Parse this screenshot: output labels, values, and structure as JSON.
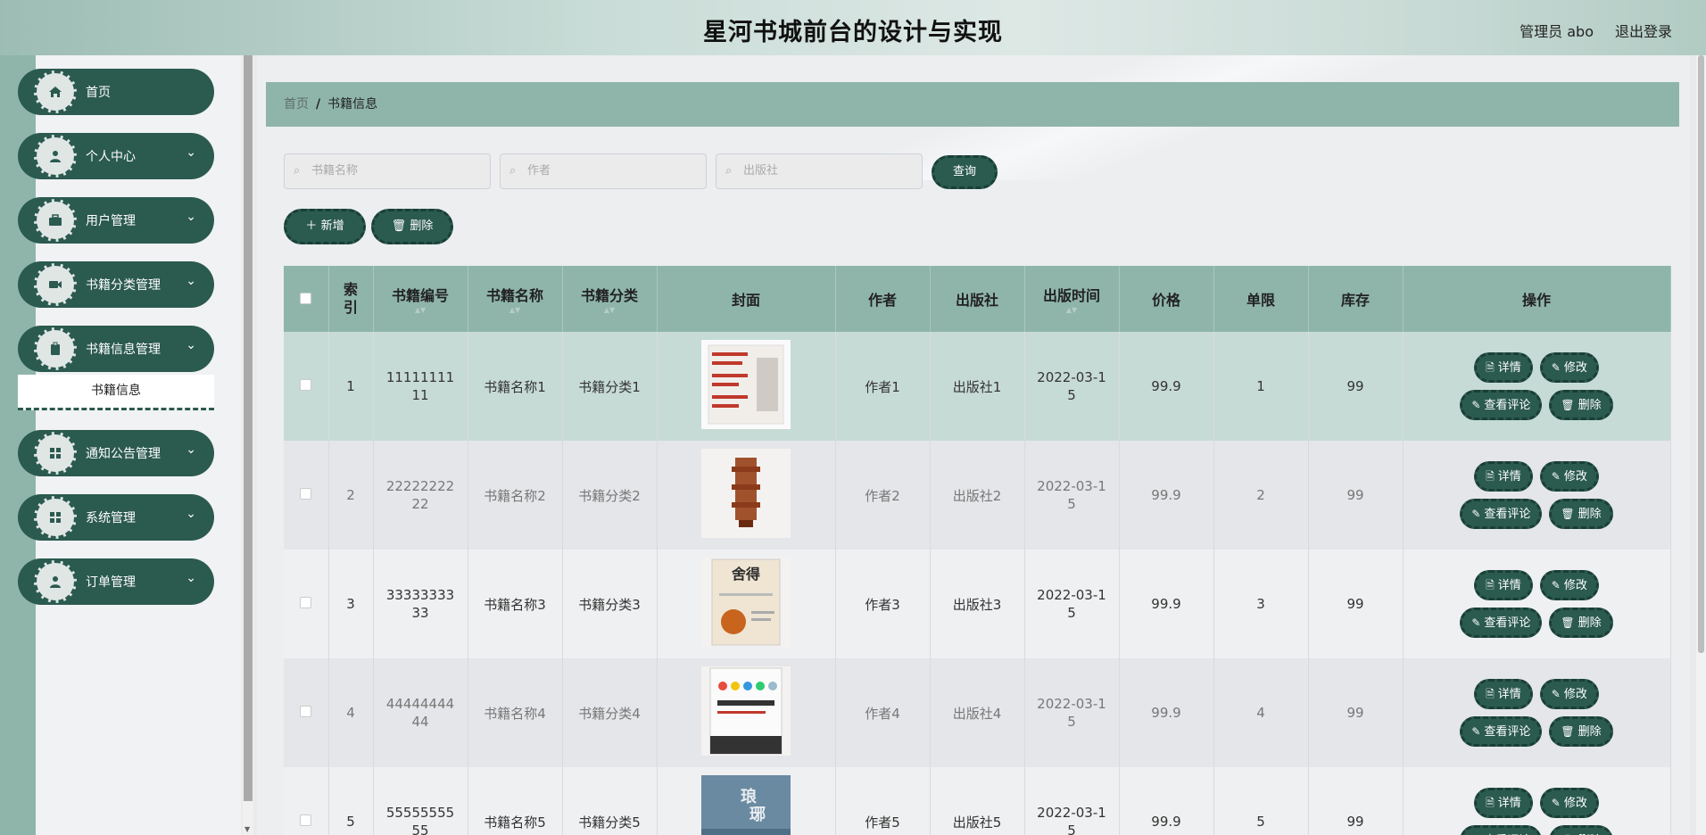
{
  "header": {
    "title": "星河书城前台的设计与实现",
    "user": "管理员 abo",
    "logout": "退出登录"
  },
  "sidebar": {
    "items": [
      {
        "label": "首页",
        "icon": "home-icon",
        "expandable": false
      },
      {
        "label": "个人中心",
        "icon": "user-icon",
        "expandable": true
      },
      {
        "label": "用户管理",
        "icon": "briefcase-icon",
        "expandable": true
      },
      {
        "label": "书籍分类管理",
        "icon": "video-icon",
        "expandable": true
      },
      {
        "label": "书籍信息管理",
        "icon": "clipboard-icon",
        "expandable": true
      },
      {
        "label": "通知公告管理",
        "icon": "grid-icon",
        "expandable": true
      },
      {
        "label": "系统管理",
        "icon": "grid-icon",
        "expandable": true
      },
      {
        "label": "订单管理",
        "icon": "user-icon",
        "expandable": true
      }
    ],
    "submenu_label": "书籍信息"
  },
  "breadcrumb": {
    "home": "首页",
    "separator": "/",
    "current": "书籍信息"
  },
  "search": {
    "name_placeholder": "书籍名称",
    "author_placeholder": "作者",
    "publisher_placeholder": "出版社",
    "query_label": "查询"
  },
  "toolbar": {
    "add_label": "新增",
    "delete_label": "删除"
  },
  "table": {
    "headers": {
      "index": "索引",
      "code": "书籍编号",
      "name": "书籍名称",
      "category": "书籍分类",
      "cover": "封面",
      "author": "作者",
      "publisher": "出版社",
      "date": "出版时间",
      "price": "价格",
      "limit": "单限",
      "stock": "库存",
      "actions": "操作"
    },
    "action_labels": {
      "detail": "详情",
      "edit": "修改",
      "comments": "查看评论",
      "delete": "删除"
    },
    "rows": [
      {
        "index": "1",
        "code": "1111111111",
        "name": "书籍名称1",
        "category": "书籍分类1",
        "author": "作者1",
        "publisher": "出版社1",
        "date": "2022-03-15",
        "price": "99.9",
        "limit": "1",
        "stock": "99"
      },
      {
        "index": "2",
        "code": "2222222222",
        "name": "书籍名称2",
        "category": "书籍分类2",
        "author": "作者2",
        "publisher": "出版社2",
        "date": "2022-03-15",
        "price": "99.9",
        "limit": "2",
        "stock": "99"
      },
      {
        "index": "3",
        "code": "3333333333",
        "name": "书籍名称3",
        "category": "书籍分类3",
        "author": "作者3",
        "publisher": "出版社3",
        "date": "2022-03-15",
        "price": "99.9",
        "limit": "3",
        "stock": "99"
      },
      {
        "index": "4",
        "code": "4444444444",
        "name": "书籍名称4",
        "category": "书籍分类4",
        "author": "作者4",
        "publisher": "出版社4",
        "date": "2022-03-15",
        "price": "99.9",
        "limit": "4",
        "stock": "99"
      },
      {
        "index": "5",
        "code": "5555555555",
        "name": "书籍名称5",
        "category": "书籍分类5",
        "author": "作者5",
        "publisher": "出版社5",
        "date": "2022-03-15",
        "price": "99.9",
        "limit": "5",
        "stock": "99"
      }
    ]
  },
  "colors": {
    "primary": "#2b5a4f",
    "accent": "#8fb5ab",
    "highlight_row": "#c7dbd6"
  }
}
